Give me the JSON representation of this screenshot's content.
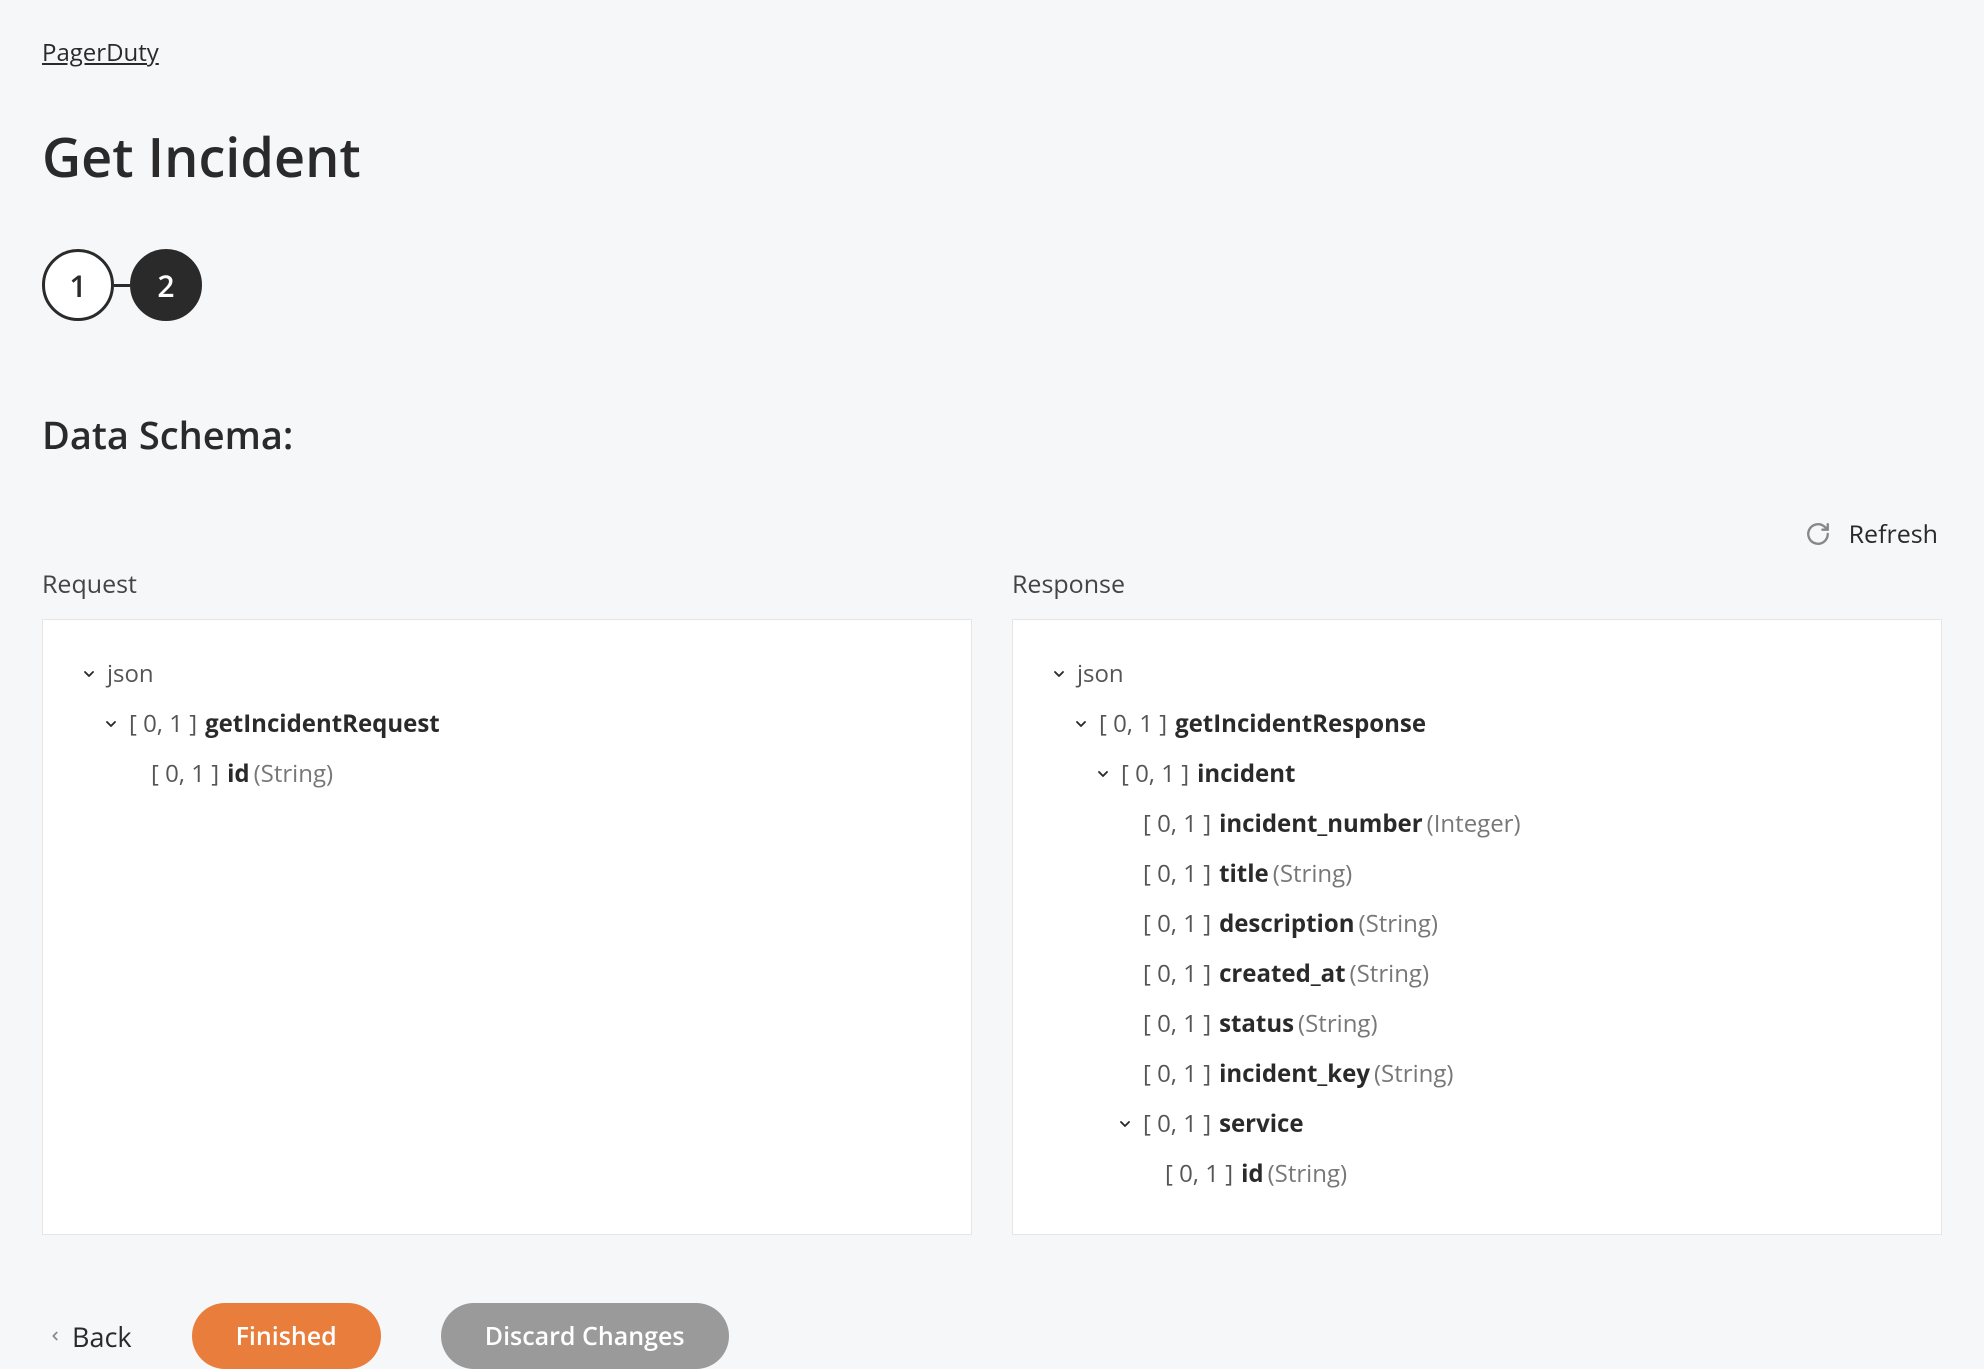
{
  "breadcrumb": {
    "parent": "PagerDuty"
  },
  "title": "Get Incident",
  "stepper": {
    "steps": [
      "1",
      "2"
    ],
    "activeIndex": 1
  },
  "sectionHeader": "Data Schema:",
  "refresh": {
    "label": "Refresh"
  },
  "request": {
    "header": "Request",
    "root": "json",
    "nodes": [
      {
        "level": 1,
        "expandable": true,
        "cardinality": "[ 0, 1 ]",
        "name": "getIncidentRequest"
      },
      {
        "level": 2,
        "expandable": false,
        "cardinality": "[ 0, 1 ]",
        "name": "id",
        "type": "(String)"
      }
    ]
  },
  "response": {
    "header": "Response",
    "root": "json",
    "nodes": [
      {
        "level": 1,
        "expandable": true,
        "cardinality": "[ 0, 1 ]",
        "name": "getIncidentResponse"
      },
      {
        "level": 2,
        "expandable": true,
        "cardinality": "[ 0, 1 ]",
        "name": "incident"
      },
      {
        "level": 3,
        "expandable": false,
        "cardinality": "[ 0, 1 ]",
        "name": "incident_number",
        "type": "(Integer)"
      },
      {
        "level": 3,
        "expandable": false,
        "cardinality": "[ 0, 1 ]",
        "name": "title",
        "type": "(String)"
      },
      {
        "level": 3,
        "expandable": false,
        "cardinality": "[ 0, 1 ]",
        "name": "description",
        "type": "(String)"
      },
      {
        "level": 3,
        "expandable": false,
        "cardinality": "[ 0, 1 ]",
        "name": "created_at",
        "type": "(String)"
      },
      {
        "level": 3,
        "expandable": false,
        "cardinality": "[ 0, 1 ]",
        "name": "status",
        "type": "(String)"
      },
      {
        "level": 3,
        "expandable": false,
        "cardinality": "[ 0, 1 ]",
        "name": "incident_key",
        "type": "(String)"
      },
      {
        "level": 3,
        "expandable": true,
        "cardinality": "[ 0, 1 ]",
        "name": "service"
      },
      {
        "level": 4,
        "expandable": false,
        "cardinality": "[ 0, 1 ]",
        "name": "id",
        "type": "(String)"
      }
    ]
  },
  "footer": {
    "back": "Back",
    "finished": "Finished",
    "discard": "Discard Changes"
  },
  "colors": {
    "primary": "#e97d3c",
    "secondary": "#9a9a9a",
    "pageBg": "#f6f7f8",
    "panelBg": "#ffffff"
  }
}
